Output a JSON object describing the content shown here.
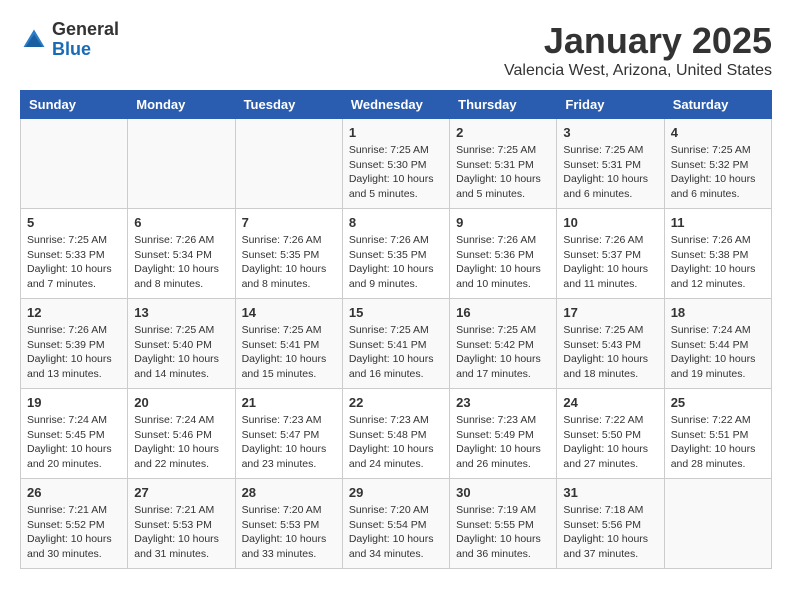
{
  "header": {
    "logo_general": "General",
    "logo_blue": "Blue",
    "title": "January 2025",
    "subtitle": "Valencia West, Arizona, United States"
  },
  "weekdays": [
    "Sunday",
    "Monday",
    "Tuesday",
    "Wednesday",
    "Thursday",
    "Friday",
    "Saturday"
  ],
  "weeks": [
    [
      {
        "day": "",
        "info": ""
      },
      {
        "day": "",
        "info": ""
      },
      {
        "day": "",
        "info": ""
      },
      {
        "day": "1",
        "info": "Sunrise: 7:25 AM\nSunset: 5:30 PM\nDaylight: 10 hours\nand 5 minutes."
      },
      {
        "day": "2",
        "info": "Sunrise: 7:25 AM\nSunset: 5:31 PM\nDaylight: 10 hours\nand 5 minutes."
      },
      {
        "day": "3",
        "info": "Sunrise: 7:25 AM\nSunset: 5:31 PM\nDaylight: 10 hours\nand 6 minutes."
      },
      {
        "day": "4",
        "info": "Sunrise: 7:25 AM\nSunset: 5:32 PM\nDaylight: 10 hours\nand 6 minutes."
      }
    ],
    [
      {
        "day": "5",
        "info": "Sunrise: 7:25 AM\nSunset: 5:33 PM\nDaylight: 10 hours\nand 7 minutes."
      },
      {
        "day": "6",
        "info": "Sunrise: 7:26 AM\nSunset: 5:34 PM\nDaylight: 10 hours\nand 8 minutes."
      },
      {
        "day": "7",
        "info": "Sunrise: 7:26 AM\nSunset: 5:35 PM\nDaylight: 10 hours\nand 8 minutes."
      },
      {
        "day": "8",
        "info": "Sunrise: 7:26 AM\nSunset: 5:35 PM\nDaylight: 10 hours\nand 9 minutes."
      },
      {
        "day": "9",
        "info": "Sunrise: 7:26 AM\nSunset: 5:36 PM\nDaylight: 10 hours\nand 10 minutes."
      },
      {
        "day": "10",
        "info": "Sunrise: 7:26 AM\nSunset: 5:37 PM\nDaylight: 10 hours\nand 11 minutes."
      },
      {
        "day": "11",
        "info": "Sunrise: 7:26 AM\nSunset: 5:38 PM\nDaylight: 10 hours\nand 12 minutes."
      }
    ],
    [
      {
        "day": "12",
        "info": "Sunrise: 7:26 AM\nSunset: 5:39 PM\nDaylight: 10 hours\nand 13 minutes."
      },
      {
        "day": "13",
        "info": "Sunrise: 7:25 AM\nSunset: 5:40 PM\nDaylight: 10 hours\nand 14 minutes."
      },
      {
        "day": "14",
        "info": "Sunrise: 7:25 AM\nSunset: 5:41 PM\nDaylight: 10 hours\nand 15 minutes."
      },
      {
        "day": "15",
        "info": "Sunrise: 7:25 AM\nSunset: 5:41 PM\nDaylight: 10 hours\nand 16 minutes."
      },
      {
        "day": "16",
        "info": "Sunrise: 7:25 AM\nSunset: 5:42 PM\nDaylight: 10 hours\nand 17 minutes."
      },
      {
        "day": "17",
        "info": "Sunrise: 7:25 AM\nSunset: 5:43 PM\nDaylight: 10 hours\nand 18 minutes."
      },
      {
        "day": "18",
        "info": "Sunrise: 7:24 AM\nSunset: 5:44 PM\nDaylight: 10 hours\nand 19 minutes."
      }
    ],
    [
      {
        "day": "19",
        "info": "Sunrise: 7:24 AM\nSunset: 5:45 PM\nDaylight: 10 hours\nand 20 minutes."
      },
      {
        "day": "20",
        "info": "Sunrise: 7:24 AM\nSunset: 5:46 PM\nDaylight: 10 hours\nand 22 minutes."
      },
      {
        "day": "21",
        "info": "Sunrise: 7:23 AM\nSunset: 5:47 PM\nDaylight: 10 hours\nand 23 minutes."
      },
      {
        "day": "22",
        "info": "Sunrise: 7:23 AM\nSunset: 5:48 PM\nDaylight: 10 hours\nand 24 minutes."
      },
      {
        "day": "23",
        "info": "Sunrise: 7:23 AM\nSunset: 5:49 PM\nDaylight: 10 hours\nand 26 minutes."
      },
      {
        "day": "24",
        "info": "Sunrise: 7:22 AM\nSunset: 5:50 PM\nDaylight: 10 hours\nand 27 minutes."
      },
      {
        "day": "25",
        "info": "Sunrise: 7:22 AM\nSunset: 5:51 PM\nDaylight: 10 hours\nand 28 minutes."
      }
    ],
    [
      {
        "day": "26",
        "info": "Sunrise: 7:21 AM\nSunset: 5:52 PM\nDaylight: 10 hours\nand 30 minutes."
      },
      {
        "day": "27",
        "info": "Sunrise: 7:21 AM\nSunset: 5:53 PM\nDaylight: 10 hours\nand 31 minutes."
      },
      {
        "day": "28",
        "info": "Sunrise: 7:20 AM\nSunset: 5:53 PM\nDaylight: 10 hours\nand 33 minutes."
      },
      {
        "day": "29",
        "info": "Sunrise: 7:20 AM\nSunset: 5:54 PM\nDaylight: 10 hours\nand 34 minutes."
      },
      {
        "day": "30",
        "info": "Sunrise: 7:19 AM\nSunset: 5:55 PM\nDaylight: 10 hours\nand 36 minutes."
      },
      {
        "day": "31",
        "info": "Sunrise: 7:18 AM\nSunset: 5:56 PM\nDaylight: 10 hours\nand 37 minutes."
      },
      {
        "day": "",
        "info": ""
      }
    ]
  ]
}
